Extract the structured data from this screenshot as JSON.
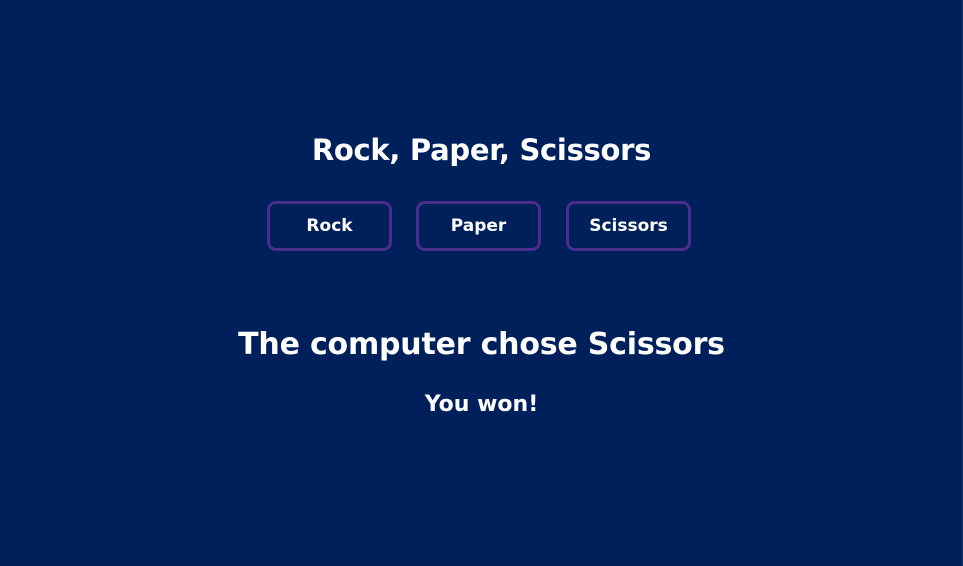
{
  "app": {
    "title": "Rock, Paper, Scissors"
  },
  "choices": [
    {
      "label": "Rock"
    },
    {
      "label": "Paper"
    },
    {
      "label": "Scissors"
    }
  ],
  "outcome": {
    "computer_choice_text": "The computer chose Scissors",
    "result_text": "You won!"
  },
  "colors": {
    "background": "#00205b",
    "button_border": "#4a2d8c",
    "text": "#ffffff"
  }
}
